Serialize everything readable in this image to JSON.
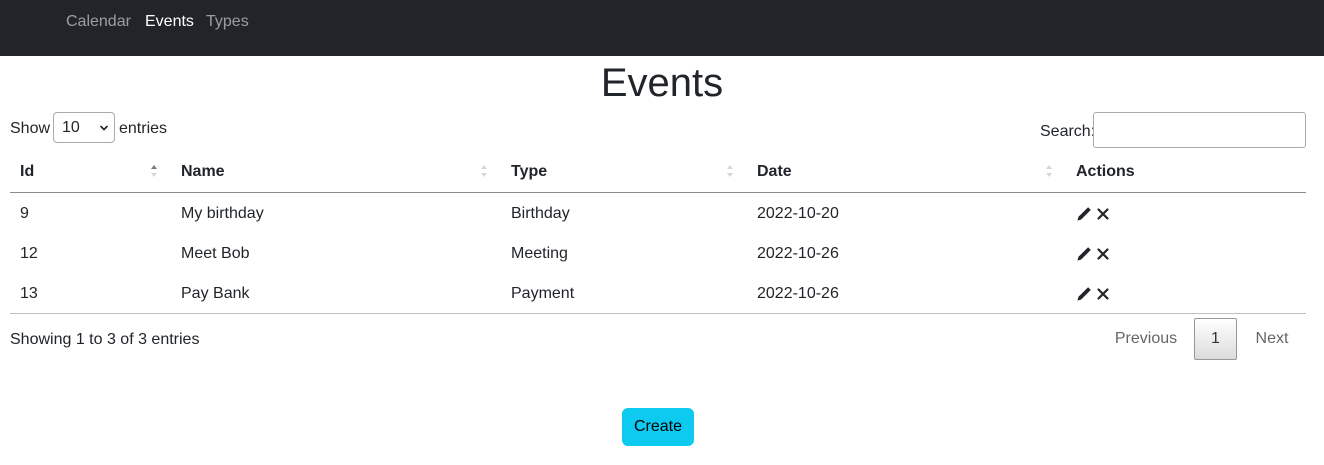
{
  "nav": {
    "items": [
      {
        "label": "Calendar",
        "active": false
      },
      {
        "label": "Events",
        "active": true
      },
      {
        "label": "Types",
        "active": false
      }
    ]
  },
  "page": {
    "title": "Events"
  },
  "table_controls": {
    "show_label": "Show",
    "page_length": "10",
    "entries_label": "entries",
    "search_label": "Search:",
    "search_value": ""
  },
  "table": {
    "columns": [
      "Id",
      "Name",
      "Type",
      "Date",
      "Actions"
    ],
    "sorted_column": "Id",
    "sort_direction": "ascending",
    "rows": [
      {
        "id": "9",
        "name": "My birthday",
        "type": "Birthday",
        "date": "2022-10-20"
      },
      {
        "id": "12",
        "name": "Meet Bob",
        "type": "Meeting",
        "date": "2022-10-26"
      },
      {
        "id": "13",
        "name": "Pay Bank",
        "type": "Payment",
        "date": "2022-10-26"
      }
    ],
    "row_actions": [
      "pencil-icon",
      "close-icon"
    ]
  },
  "footer": {
    "info": "Showing 1 to 3 of 3 entries",
    "pagination": {
      "previous": "Previous",
      "current": "1",
      "next": "Next"
    }
  },
  "actions": {
    "create_label": "Create"
  },
  "colors": {
    "navbar": "#212529",
    "create_button": "#0dcaf0",
    "text": "#212529"
  }
}
